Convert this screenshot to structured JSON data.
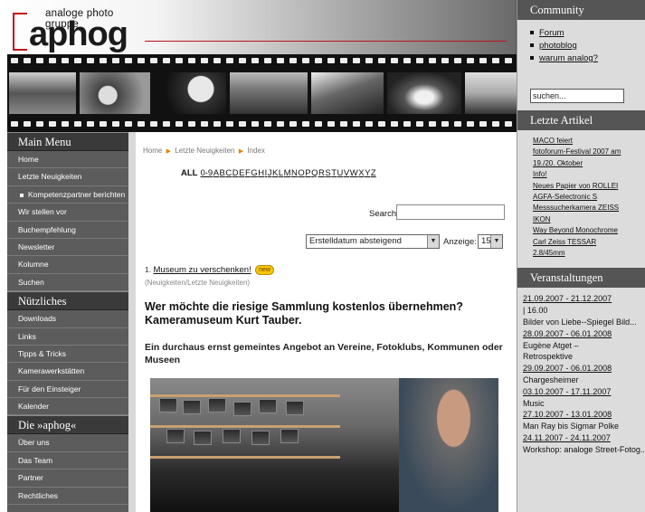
{
  "logo": {
    "tagline": "analoge photo gruppe",
    "word": "aphog"
  },
  "breadcrumb": [
    "Home",
    "Letzte Neuigkeiten",
    "Index"
  ],
  "alphabet": [
    "ALL",
    "0-9",
    "A",
    "B",
    "C",
    "D",
    "E",
    "F",
    "G",
    "H",
    "I",
    "J",
    "K",
    "L",
    "M",
    "N",
    "O",
    "P",
    "Q",
    "R",
    "S",
    "T",
    "U",
    "V",
    "W",
    "X",
    "Y",
    "Z"
  ],
  "search": {
    "label": "Search",
    "value": ""
  },
  "sort": {
    "value": "Erstelldatum absteigend",
    "count_label": "Anzeige:",
    "count_value": "15"
  },
  "main_menu": {
    "title": "Main Menu",
    "items": [
      "Home",
      "Letzte Neuigkeiten",
      "Kompetenzpartner berichten",
      "Wir stellen vor",
      "Buchempfehlung",
      "Newsletter",
      "Kolumne",
      "Suchen"
    ]
  },
  "nuetzliches": {
    "title": "Nützliches",
    "items": [
      "Downloads",
      "Links",
      "Tipps & Tricks",
      "Kamerawerkstätten",
      "Für den Einsteiger",
      "Kalender"
    ]
  },
  "aphog": {
    "title": "Die »aphog«",
    "items": [
      "Über uns",
      "Das Team",
      "Partner",
      "Rechtliches"
    ]
  },
  "article": {
    "number": "1.",
    "link": "Museum zu verschenken!",
    "badge": "new",
    "category": "(Neuigkeiten/Letzte Neuigkeiten)",
    "title": "Wer möchte die riesige Sammlung kostenlos übernehmen? Kameramuseum Kurt Tauber.",
    "subtitle": "Ein durchaus ernst gemeintes Angebot an Vereine, Fotoklubs, Kommunen oder Museen"
  },
  "community": {
    "title": "Community",
    "items": [
      "Forum",
      "photoblog",
      "warum analog?"
    ],
    "search_value": "suchen..."
  },
  "letzte_artikel": {
    "title": "Letzte Artikel",
    "items": [
      "MACO feiert",
      "fotoforum-Festival 2007 am",
      "19./20. Oktober",
      "Info!",
      "Neues Papier von ROLLEI",
      "AGFA-Selectronic S",
      "Messsucherkamera ZEISS",
      "IKON",
      "Way Beyond Monochrome",
      "Carl Zeiss TESSAR",
      "2.8/45mm"
    ]
  },
  "veranstaltungen": {
    "title": "Veranstaltungen",
    "events": [
      {
        "date": "21.09.2007 - 21.12.2007",
        "title": "| 16.00"
      },
      {
        "date": "",
        "title": "Bilder von Liebe--Spiegel Bild..."
      },
      {
        "date": "28.09.2007 - 06.01.2008",
        "title": "Eugène Atget –"
      },
      {
        "date": "",
        "title": "Retrospektive"
      },
      {
        "date": "29.09.2007 - 06.01.2008",
        "title": "Chargesheimer"
      },
      {
        "date": "03.10.2007 - 17.11.2007",
        "title": "Music"
      },
      {
        "date": "27.10.2007 - 13.01.2008",
        "title": "Man Ray bis Sigmar Polke"
      },
      {
        "date": "24.11.2007 - 24.11.2007",
        "title": "Workshop: analoge Street-Fotog..."
      }
    ]
  }
}
